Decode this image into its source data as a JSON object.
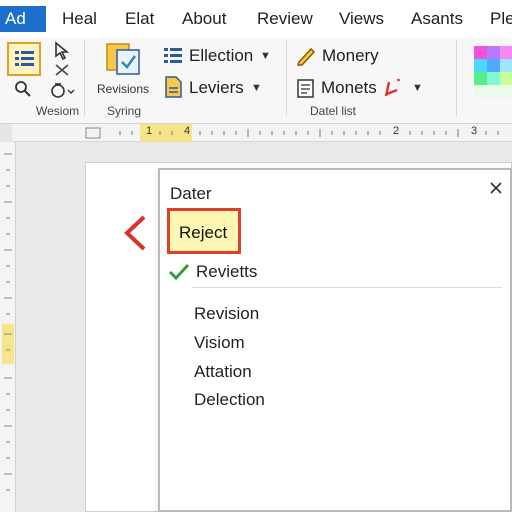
{
  "tabs": [
    {
      "label": "Ad",
      "active": true
    },
    {
      "label": "Heal"
    },
    {
      "label": "Elat"
    },
    {
      "label": "About"
    },
    {
      "label": "Review"
    },
    {
      "label": "Views"
    },
    {
      "label": "Asants"
    },
    {
      "label": "Ple"
    }
  ],
  "ribbon": {
    "group1_caption": "Wesiom",
    "revisions_label": "Revisions",
    "group2_caption": "Syring",
    "ellection_label": "Ellection",
    "leviers_label": "Leviers",
    "monery_label": "Monery",
    "monets_label": "Monets",
    "group3_caption": "Datel list"
  },
  "ruler": {
    "marks": [
      "1",
      "4",
      "2",
      "3"
    ]
  },
  "dialog": {
    "title": "Dater",
    "reject_label": "Reject",
    "checked_label": "Revietts",
    "options": [
      "Revision",
      "Visiom",
      "Attation",
      "Delection"
    ]
  },
  "colors": {
    "accent_tab": "#1e6fc9",
    "highlight_fill": "#fff6b3",
    "highlight_border": "#e0402a",
    "check": "#3a9a35"
  },
  "icons": [
    "list-icon",
    "pointer-icon",
    "scissors-icon",
    "search-icon",
    "circle-icon",
    "revisions-icon",
    "list-bullets-icon",
    "document-icon",
    "pen-icon",
    "monets-icon",
    "color-grid-icon",
    "close-icon",
    "checkmark-icon",
    "arrow-left-icon"
  ]
}
